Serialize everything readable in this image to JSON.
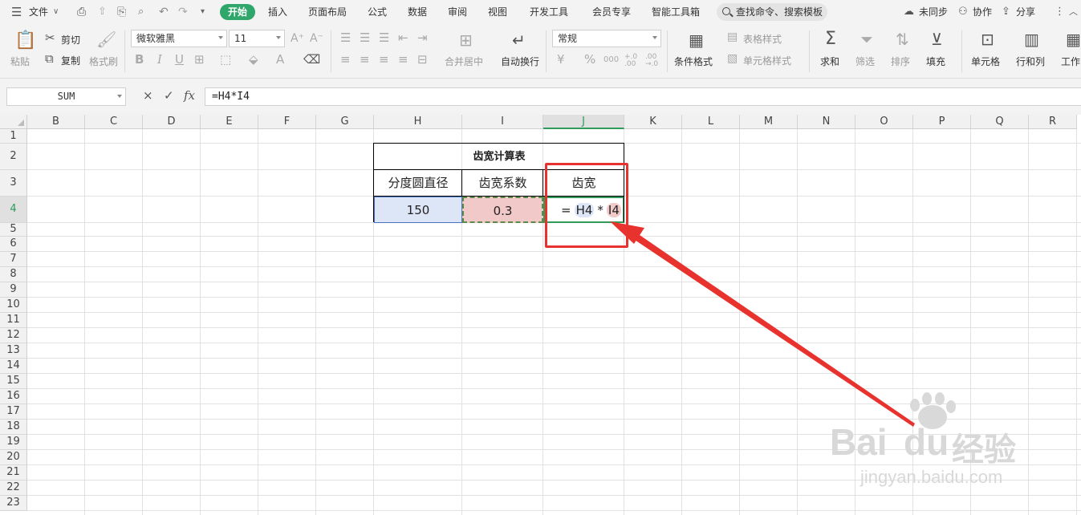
{
  "menu": {
    "file": "文件",
    "tabs": [
      "开始",
      "插入",
      "页面布局",
      "公式",
      "数据",
      "审阅",
      "视图",
      "开发工具",
      "会员专享",
      "智能工具箱"
    ],
    "search": "查找命令、搜索模板",
    "right": [
      "未同步",
      "协作",
      "分享"
    ]
  },
  "ribbon": {
    "paste": "粘贴",
    "cut": "剪切",
    "copy": "复制",
    "format_painter": "格式刷",
    "font_name": "微软雅黑",
    "font_size": "11",
    "bold": "B",
    "italic": "I",
    "underline": "U",
    "merge_center": "合并居中",
    "wrap_text": "自动换行",
    "number_format": "常规",
    "currency": "¥",
    "percent": "%",
    "thousands": "000",
    "inc_decimal": "+.0 .00",
    "dec_decimal": ".00 →.0",
    "conditional": "条件格式",
    "table_style": "表格样式",
    "cell_style": "单元格样式",
    "sum": "求和",
    "filter": "筛选",
    "sort": "排序",
    "fill": "填充",
    "cells": "单元格",
    "rows_cols": "行和列",
    "worksheet": "工作"
  },
  "formula_bar": {
    "name_box": "SUM",
    "cancel": "×",
    "enter": "✓",
    "fx": "fx",
    "formula": "=H4*I4"
  },
  "columns": [
    "B",
    "C",
    "D",
    "E",
    "F",
    "G",
    "H",
    "I",
    "J",
    "K",
    "L",
    "M",
    "N",
    "O",
    "P",
    "Q",
    "R"
  ],
  "rows": [
    "1",
    "2",
    "3",
    "4",
    "5",
    "6",
    "7",
    "8",
    "9",
    "10",
    "11",
    "12",
    "13",
    "14",
    "15",
    "16",
    "17",
    "18",
    "19",
    "20",
    "21",
    "22",
    "23"
  ],
  "table": {
    "title": "齿宽计算表",
    "headers": [
      "分度圆直径",
      "齿宽系数",
      "齿宽"
    ],
    "values": [
      "150",
      "0.3"
    ],
    "edit_eq": "=",
    "edit_ref1": "H4",
    "edit_op": "*",
    "edit_ref2": "I4"
  },
  "watermark": {
    "brand": "Bai",
    "brand2": "du",
    "cn": "经验",
    "url": "jingyan.baidu.com"
  },
  "colors": {
    "accent_green": "#2fa66a",
    "ref_blue": "#dde6f7",
    "ref_red": "#f2c9c9",
    "annotation_red": "#e8322e"
  }
}
